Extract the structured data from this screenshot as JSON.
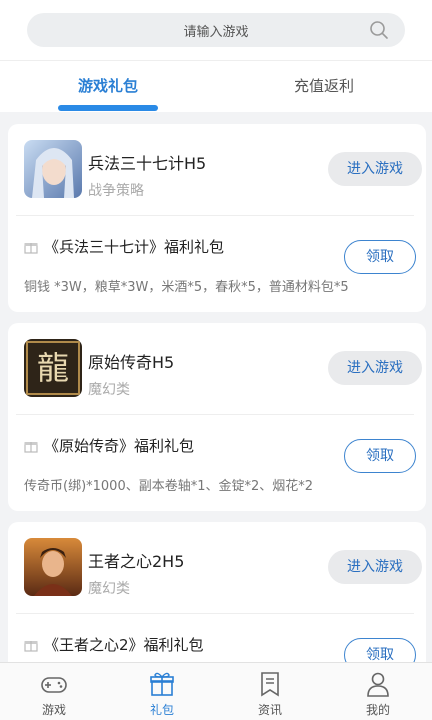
{
  "search": {
    "placeholder": "请输入游戏"
  },
  "tabs": [
    {
      "label": "游戏礼包",
      "active": true
    },
    {
      "label": "充值返利",
      "active": false
    }
  ],
  "games": [
    {
      "name": "兵法三十七计H5",
      "category": "战争策略",
      "enter_label": "进入游戏",
      "gift_title": "《兵法三十七计》福利礼包",
      "claim_label": "领取",
      "gift_desc": "铜钱 *3W，粮草*3W，米酒*5，春秋*5，普通材料包*5",
      "icon_color": "#8fb1d8"
    },
    {
      "name": "原始传奇H5",
      "category": "魔幻类",
      "enter_label": "进入游戏",
      "gift_title": "《原始传奇》福利礼包",
      "claim_label": "领取",
      "gift_desc": "传奇币(绑)*1000、副本卷轴*1、金锭*2、烟花*2",
      "icon_color": "#3a2a1c"
    },
    {
      "name": "王者之心2H5",
      "category": "魔幻类",
      "enter_label": "进入游戏",
      "gift_title": "《王者之心2》福利礼包",
      "claim_label": "领取",
      "gift_desc": "",
      "icon_color": "#9a4a22"
    }
  ],
  "nav": [
    {
      "label": "游戏",
      "icon": "gamepad-icon",
      "active": false
    },
    {
      "label": "礼包",
      "icon": "gift-icon",
      "active": true
    },
    {
      "label": "资讯",
      "icon": "news-icon",
      "active": false
    },
    {
      "label": "我的",
      "icon": "profile-icon",
      "active": false
    }
  ],
  "colors": {
    "accent": "#2a7fd4",
    "background": "#f2f3f5"
  }
}
